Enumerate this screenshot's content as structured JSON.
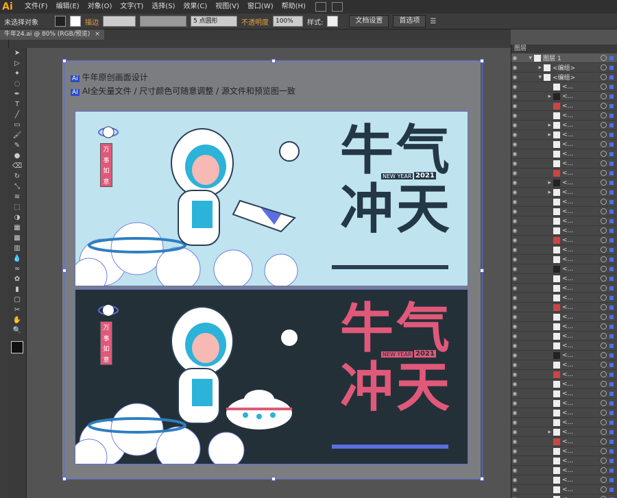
{
  "app": {
    "logo": "Ai"
  },
  "menu": [
    "文件(F)",
    "编辑(E)",
    "对象(O)",
    "文字(T)",
    "选择(S)",
    "效果(C)",
    "视图(V)",
    "窗口(W)",
    "帮助(H)"
  ],
  "control": {
    "selection": "未选择对象",
    "stroke_label": "描边",
    "brush_label": "5 点圆形",
    "opacity_label": "不透明度",
    "opacity_value": "100%",
    "style_label": "样式:",
    "doc_setup": "文档设置",
    "prefs": "首选项"
  },
  "tab": {
    "title": "牛年24.ai @ 80% (RGB/预览)"
  },
  "art": {
    "line1": "牛年原创画面设计",
    "line1_badge": "Ai",
    "line2": "AI全矢量文件 / 尺寸颜色可随意调整 / 源文件和预览图一致",
    "line2_badge": "AI",
    "tag_chars": [
      "万",
      "事",
      "如",
      "意"
    ],
    "headline": [
      "牛",
      "气",
      "冲",
      "天"
    ],
    "year": "2021",
    "new_year": "NEW YEAR"
  },
  "layers": {
    "panel_title": "图层",
    "rows": [
      {
        "label": "图层 1",
        "expand": "▾"
      },
      {
        "label": "<编组>",
        "expand": "▸"
      },
      {
        "label": "<编组>",
        "expand": "▾"
      },
      {
        "label": "<...",
        "expand": ""
      },
      {
        "label": "<...",
        "expand": "▸"
      },
      {
        "label": "<...",
        "expand": ""
      },
      {
        "label": "<...",
        "expand": ""
      },
      {
        "label": "<...",
        "expand": "▸"
      },
      {
        "label": "<...",
        "expand": "▸"
      },
      {
        "label": "<...",
        "expand": ""
      },
      {
        "label": "<...",
        "expand": ""
      },
      {
        "label": "<...",
        "expand": ""
      },
      {
        "label": "<...",
        "expand": ""
      },
      {
        "label": "<...",
        "expand": "▸"
      },
      {
        "label": "<...",
        "expand": "▸"
      },
      {
        "label": "<...",
        "expand": ""
      },
      {
        "label": "<...",
        "expand": ""
      },
      {
        "label": "<...",
        "expand": ""
      },
      {
        "label": "<...",
        "expand": ""
      },
      {
        "label": "<...",
        "expand": ""
      },
      {
        "label": "<...",
        "expand": ""
      },
      {
        "label": "<...",
        "expand": ""
      },
      {
        "label": "<...",
        "expand": ""
      },
      {
        "label": "<...",
        "expand": ""
      },
      {
        "label": "<...",
        "expand": ""
      },
      {
        "label": "<...",
        "expand": ""
      },
      {
        "label": "<...",
        "expand": ""
      },
      {
        "label": "<...",
        "expand": ""
      },
      {
        "label": "<...",
        "expand": ""
      },
      {
        "label": "<...",
        "expand": ""
      },
      {
        "label": "<...",
        "expand": ""
      },
      {
        "label": "<...",
        "expand": ""
      },
      {
        "label": "<...",
        "expand": ""
      },
      {
        "label": "<...",
        "expand": ""
      },
      {
        "label": "<...",
        "expand": ""
      },
      {
        "label": "<...",
        "expand": ""
      },
      {
        "label": "<...",
        "expand": ""
      },
      {
        "label": "<...",
        "expand": ""
      },
      {
        "label": "<...",
        "expand": ""
      },
      {
        "label": "<...",
        "expand": "▸"
      },
      {
        "label": "<...",
        "expand": ""
      },
      {
        "label": "<...",
        "expand": ""
      },
      {
        "label": "<...",
        "expand": ""
      },
      {
        "label": "<...",
        "expand": ""
      },
      {
        "label": "<...",
        "expand": ""
      },
      {
        "label": "<...",
        "expand": ""
      },
      {
        "label": "<...",
        "expand": ""
      },
      {
        "label": "<...",
        "expand": ""
      }
    ]
  },
  "colors": {
    "light_bg": "#bfe3ef",
    "dark_bg": "#243038",
    "navy": "#233747",
    "pink": "#e0597a",
    "selection": "#5b6ee0"
  },
  "tools": [
    "selection-arrow-icon",
    "direct-select-icon",
    "magic-wand-icon",
    "lasso-icon",
    "pen-icon",
    "type-icon",
    "line-icon",
    "rectangle-icon",
    "paintbrush-icon",
    "pencil-icon",
    "blob-brush-icon",
    "eraser-icon",
    "rotate-icon",
    "scale-icon",
    "width-icon",
    "free-transform-icon",
    "shape-builder-icon",
    "perspective-icon",
    "mesh-icon",
    "gradient-icon",
    "eyedropper-icon",
    "blend-icon",
    "symbol-sprayer-icon",
    "graph-icon",
    "artboard-icon",
    "slice-icon",
    "hand-icon",
    "zoom-icon"
  ]
}
